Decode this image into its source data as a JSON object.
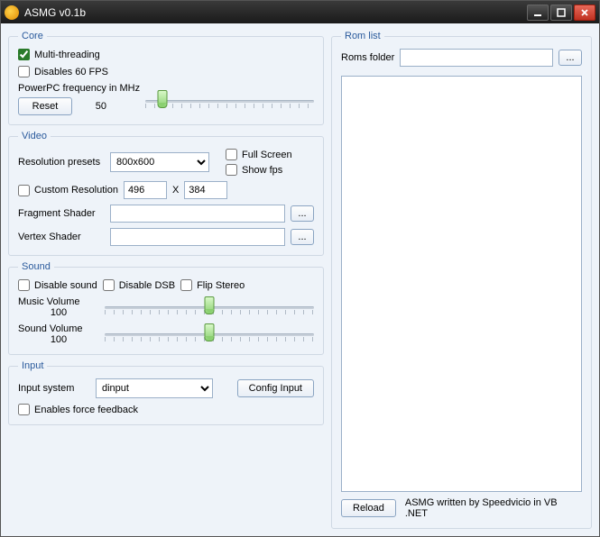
{
  "window": {
    "title": "ASMG v0.1b"
  },
  "core": {
    "legend": "Core",
    "multithreading_label": "Multi-threading",
    "multithreading_checked": true,
    "disable60_label": "Disables 60 FPS",
    "disable60_checked": false,
    "freq_label": "PowerPC frequency in MHz",
    "freq_value": "50",
    "reset_label": "Reset",
    "slider_pos_pct": 10
  },
  "video": {
    "legend": "Video",
    "res_preset_label": "Resolution presets",
    "res_preset_value": "800x600",
    "fullscreen_label": "Full Screen",
    "showfps_label": "Show fps",
    "custom_res_label": "Custom Resolution",
    "custom_w": "496",
    "by": "X",
    "custom_h": "384",
    "frag_label": "Fragment Shader",
    "vert_label": "Vertex Shader",
    "browse_label": "..."
  },
  "sound": {
    "legend": "Sound",
    "disable_sound_label": "Disable sound",
    "disable_dsb_label": "Disable DSB",
    "flip_stereo_label": "Flip Stereo",
    "music_label": "Music Volume",
    "music_value": "100",
    "music_pos_pct": 50,
    "sound_label": "Sound Volume",
    "sound_value": "100",
    "sound_pos_pct": 50
  },
  "input": {
    "legend": "Input",
    "system_label": "Input system",
    "system_value": "dinput",
    "config_label": "Config Input",
    "ff_label": "Enables force feedback"
  },
  "romlist": {
    "legend": "Rom list",
    "folder_label": "Roms folder",
    "browse_label": "...",
    "reload_label": "Reload",
    "credit": "ASMG written by Speedvicio in VB .NET"
  }
}
